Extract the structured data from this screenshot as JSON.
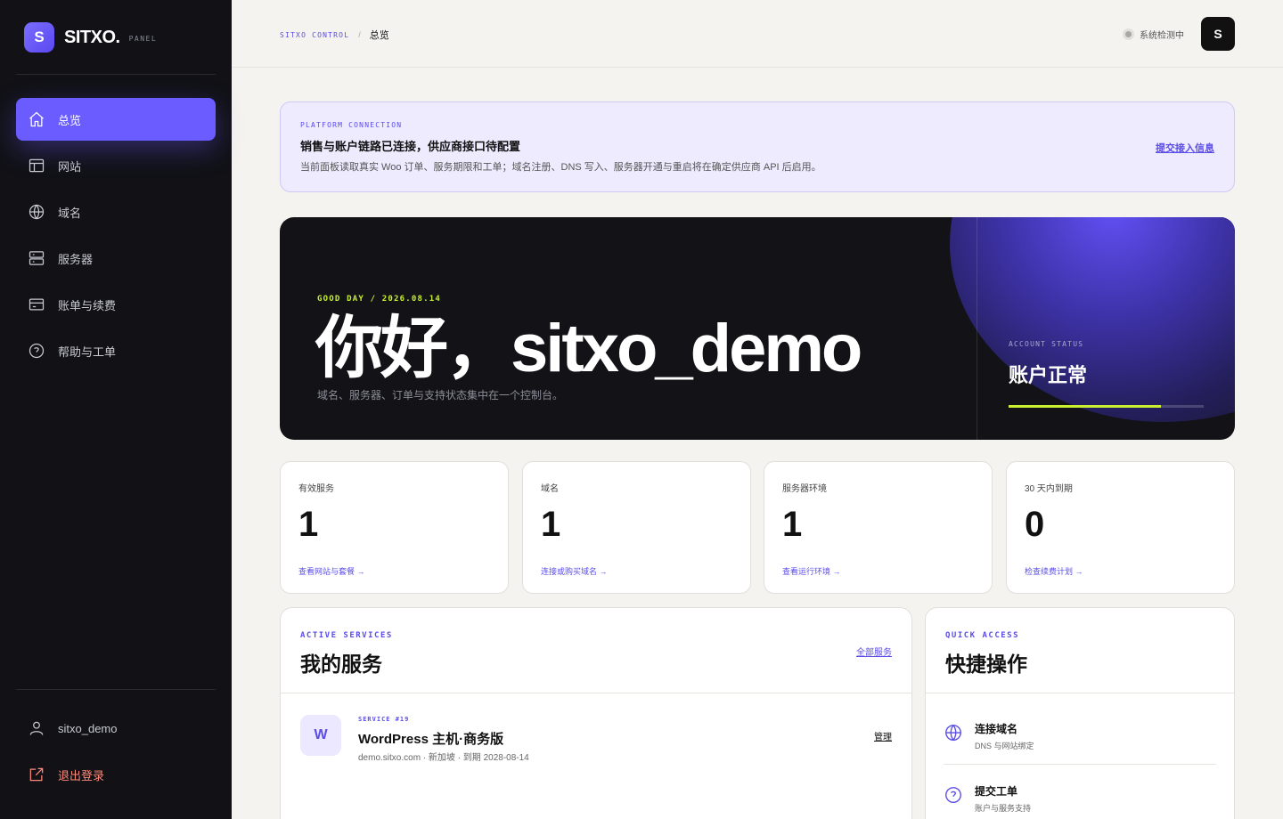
{
  "brand": {
    "mark": "S",
    "name": "SITXO.",
    "sub": "PANEL"
  },
  "nav": [
    {
      "label": "总览",
      "icon": "home-icon"
    },
    {
      "label": "网站",
      "icon": "layout-icon"
    },
    {
      "label": "域名",
      "icon": "globe-icon"
    },
    {
      "label": "服务器",
      "icon": "server-icon"
    },
    {
      "label": "账单与续费",
      "icon": "credit-card-icon"
    },
    {
      "label": "帮助与工单",
      "icon": "help-circle-icon"
    }
  ],
  "user": {
    "name": "sitxo_demo",
    "logout": "退出登录"
  },
  "topbar": {
    "crumb_root": "SITXO CONTROL",
    "crumb_sep": "/",
    "crumb_current": "总览",
    "status": "系统检测中",
    "avatar": "S"
  },
  "notice": {
    "kicker": "PLATFORM CONNECTION",
    "title": "销售与账户链路已连接，供应商接口待配置",
    "desc": "当前面板读取真实 Woo 订单、服务期限和工单；域名注册、DNS 写入、服务器开通与重启将在确定供应商 API 后启用。",
    "link": "提交接入信息"
  },
  "hero": {
    "kicker": "GOOD DAY / 2026.08.14",
    "title": "你好，sitxo_demo",
    "subtitle": "域名、服务器、订单与支持状态集中在一个控制台。",
    "account_kicker": "ACCOUNT STATUS",
    "account_status": "账户正常",
    "account_progress": 0.78
  },
  "stats": [
    {
      "label": "有效服务",
      "value": "1",
      "link": "查看网站与套餐 →"
    },
    {
      "label": "域名",
      "value": "1",
      "link": "连接或购买域名 →"
    },
    {
      "label": "服务器环境",
      "value": "1",
      "link": "查看运行环境 →"
    },
    {
      "label": "30 天内到期",
      "value": "0",
      "link": "检查续费计划 →"
    }
  ],
  "services": {
    "kicker": "ACTIVE SERVICES",
    "title": "我的服务",
    "action": "全部服务",
    "items": [
      {
        "icon_letter": "W",
        "kicker": "SERVICE #19",
        "name": "WordPress 主机·商务版",
        "meta": "demo.sitxo.com · 新加坡 · 到期 2028-08-14",
        "action": "管理"
      }
    ]
  },
  "quick": {
    "kicker": "QUICK ACCESS",
    "title": "快捷操作",
    "items": [
      {
        "title": "连接域名",
        "desc": "DNS 与网站绑定",
        "icon": "globe-icon"
      },
      {
        "title": "提交工单",
        "desc": "账户与服务支持",
        "icon": "help-circle-icon"
      }
    ]
  },
  "colors": {
    "accent": "#6a5cff",
    "lime": "#c8f030",
    "sidebar": "#111116",
    "logout": "#ff8a7a"
  }
}
